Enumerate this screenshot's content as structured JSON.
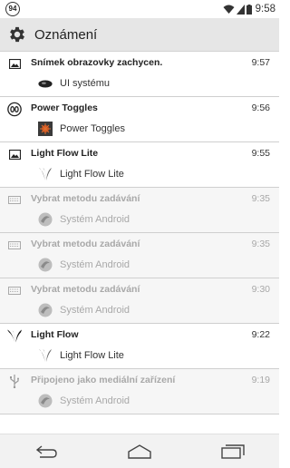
{
  "statusbar": {
    "badge": "94",
    "time": "9:58"
  },
  "appbar": {
    "title": "Oznámení"
  },
  "items": [
    {
      "title": "Snímek obrazovky zachycen.",
      "time": "9:57",
      "sub": "UI systému",
      "muted": false
    },
    {
      "title": "Power Toggles",
      "time": "9:56",
      "sub": "Power Toggles",
      "muted": false
    },
    {
      "title": "Light Flow Lite",
      "time": "9:55",
      "sub": "Light Flow Lite",
      "muted": false
    },
    {
      "title": "Vybrat metodu zadávání",
      "time": "9:35",
      "sub": "Systém Android",
      "muted": true
    },
    {
      "title": "Vybrat metodu zadávání",
      "time": "9:35",
      "sub": "Systém Android",
      "muted": true
    },
    {
      "title": "Vybrat metodu zadávání",
      "time": "9:30",
      "sub": "Systém Android",
      "muted": true
    },
    {
      "title": "Light Flow",
      "time": "9:22",
      "sub": "Light Flow Lite",
      "muted": false
    },
    {
      "title": "Připojeno jako mediální zařízení",
      "time": "9:19",
      "sub": "Systém Android",
      "muted": true
    }
  ],
  "icons": {
    "gear": "gear-icon",
    "back": "back-icon",
    "home": "home-icon",
    "recents": "recents-icon"
  }
}
